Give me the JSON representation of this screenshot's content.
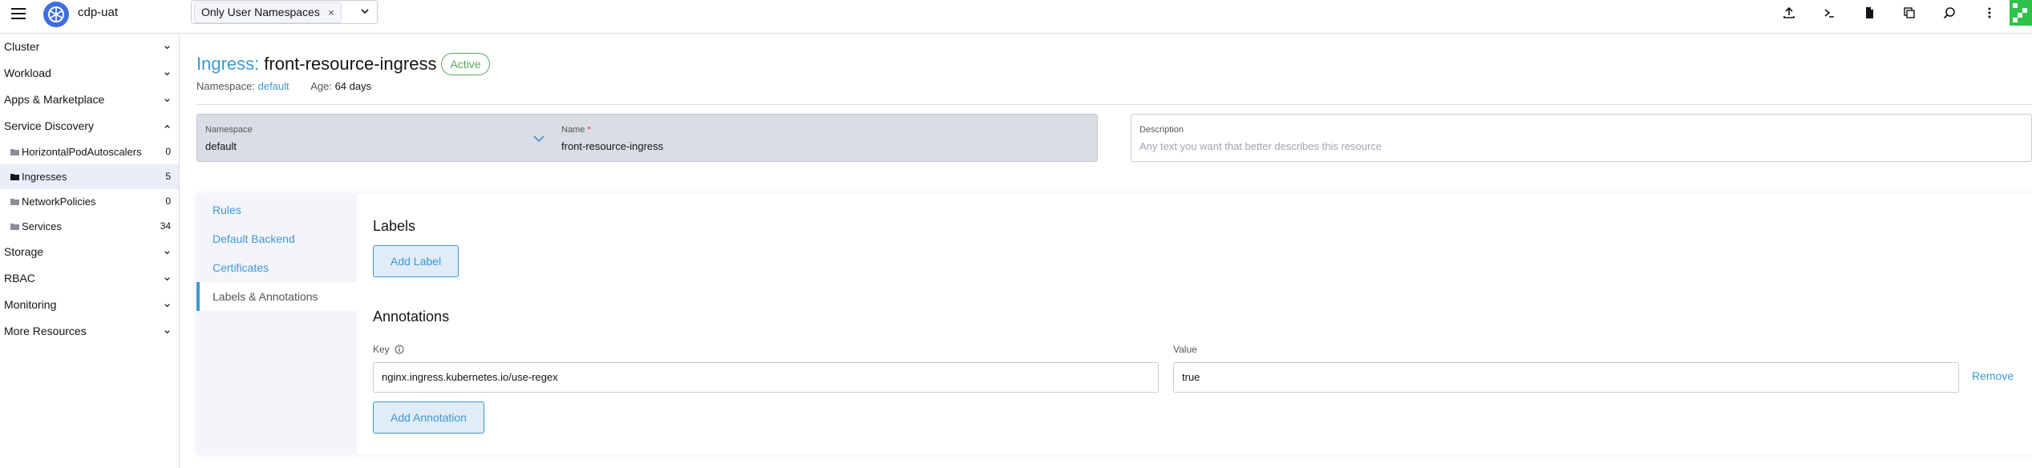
{
  "header": {
    "cluster_name": "cdp-uat",
    "namespace_filter": {
      "chip_label": "Only User Namespaces",
      "chip_remove": "×"
    },
    "actions": [
      "import-yaml-icon",
      "kubectl-shell-icon",
      "kubeconfig-download-icon",
      "copy-kubeconfig-icon",
      "search-icon",
      "more-icon"
    ]
  },
  "sidebar": {
    "groups": [
      {
        "label": "Cluster",
        "expanded": false
      },
      {
        "label": "Workload",
        "expanded": false
      },
      {
        "label": "Apps & Marketplace",
        "expanded": false
      },
      {
        "label": "Service Discovery",
        "expanded": true
      },
      {
        "label": "Storage",
        "expanded": false
      },
      {
        "label": "RBAC",
        "expanded": false
      },
      {
        "label": "Monitoring",
        "expanded": false
      },
      {
        "label": "More Resources",
        "expanded": false
      }
    ],
    "service_discovery_items": [
      {
        "label": "HorizontalPodAutoscalers",
        "count": "0"
      },
      {
        "label": "Ingresses",
        "count": "5",
        "active": true
      },
      {
        "label": "NetworkPolicies",
        "count": "0"
      },
      {
        "label": "Services",
        "count": "34"
      }
    ]
  },
  "page": {
    "kind": "Ingress:",
    "name": "front-resource-ingress",
    "state": "Active",
    "namespace_label": "Namespace:",
    "namespace_value": "default",
    "age_label": "Age:",
    "age_value": "64 days"
  },
  "form": {
    "namespace_label": "Namespace",
    "namespace_value": "default",
    "name_label": "Name",
    "name_required": "*",
    "name_value": "front-resource-ingress",
    "description_label": "Description",
    "description_placeholder": "Any text you want that better describes this resource"
  },
  "tabs": [
    {
      "label": "Rules",
      "active": false
    },
    {
      "label": "Default Backend",
      "active": false
    },
    {
      "label": "Certificates",
      "active": false
    },
    {
      "label": "Labels & Annotations",
      "active": true
    }
  ],
  "labels_section": {
    "title": "Labels",
    "add_button": "Add Label"
  },
  "annotations_section": {
    "title": "Annotations",
    "key_label": "Key",
    "value_label": "Value",
    "rows": [
      {
        "key": "nginx.ingress.kubernetes.io/use-regex",
        "value": "true",
        "remove": "Remove"
      }
    ],
    "add_button": "Add Annotation"
  },
  "colors": {
    "link": "#3d98d3",
    "active_badge": "#5ba35b",
    "avatar": "#2dc34a",
    "cluster_logo": "#3d6fe0"
  }
}
